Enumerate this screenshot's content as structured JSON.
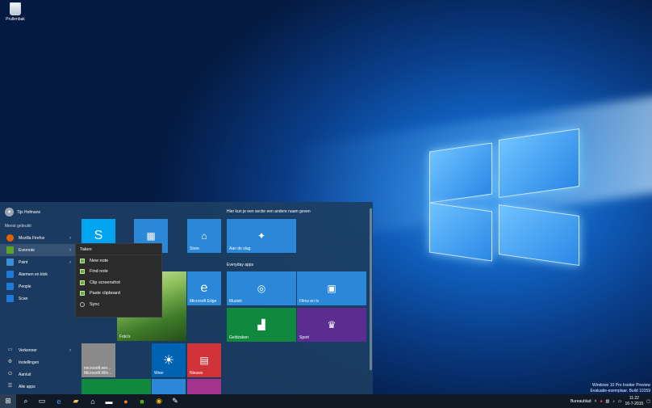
{
  "desktop": {
    "recycle_bin_label": "Prullenbak",
    "watermark": {
      "line1": "Windows 10 Pro Insider Preview",
      "line2": "Evaluatie-exemplaar. Build 10159"
    }
  },
  "start_menu": {
    "user_name": "Tijs Hofmans",
    "most_used_label": "Meest gebruikt",
    "apps": [
      {
        "label": "Mozilla Firefox",
        "icon": "firefox-icon",
        "has_arrow": true
      },
      {
        "label": "Evernote",
        "icon": "evernote-icon",
        "has_arrow": true
      },
      {
        "label": "Paint",
        "icon": "paint-icon",
        "has_arrow": true
      },
      {
        "label": "Alarmen en klok",
        "icon": "alarm-clock-icon",
        "has_arrow": false
      },
      {
        "label": "People",
        "icon": "people-icon",
        "has_arrow": false
      },
      {
        "label": "Scan",
        "icon": "scan-icon",
        "has_arrow": false
      }
    ],
    "bottom": [
      {
        "label": "Verkenner",
        "icon": "folder-icon",
        "has_arrow": true
      },
      {
        "label": "Instellingen",
        "icon": "gear-icon",
        "has_arrow": false
      },
      {
        "label": "Aan/uit",
        "icon": "power-icon",
        "has_arrow": false
      },
      {
        "label": "Alle apps",
        "icon": "all-apps-icon",
        "has_arrow": false
      }
    ],
    "context_menu": {
      "header": "Taken",
      "items": [
        "New note",
        "Find note",
        "Clip screenshot",
        "Paste clipboard",
        "Sync"
      ]
    },
    "section_headers": {
      "top": "Hier kun je een sectie een andere naam geven",
      "everyday": "Everyday apps"
    },
    "tiles": {
      "store": "Store",
      "aan_de_slag": "Aan de slag",
      "edge": "Microsoft Edge",
      "muziek": "Muziek",
      "films": "Films en tv",
      "geldzaken": "Geldzaken",
      "sport": "Sport",
      "fotos": "Foto's",
      "weer": "Weer",
      "nieuws": "Nieuws",
      "microsoft_win_1": "microsoft.win...",
      "microsoft_win_2": "Microsoft.Win..."
    }
  },
  "taskbar": {
    "desktop_label": "Bureaublad",
    "time": "11:22",
    "date": "16-7-2015"
  },
  "colors": {
    "tile_blue": "#2b88d8",
    "tile_green": "#10893e",
    "tile_purple": "#5c2d91",
    "tile_red": "#d13438",
    "tile_gray": "#767676"
  }
}
